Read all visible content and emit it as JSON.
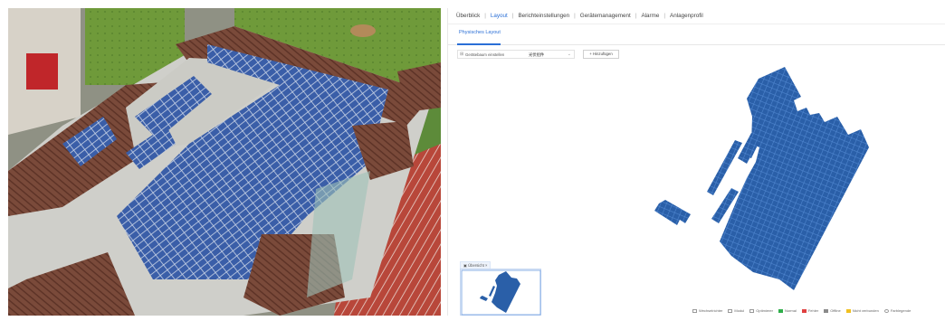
{
  "nav": {
    "items": [
      {
        "label": "Überblick",
        "active": false
      },
      {
        "label": "Layout",
        "active": true
      },
      {
        "label": "Berichteinstellungen",
        "active": false
      },
      {
        "label": "Gerätemanagement",
        "active": false
      },
      {
        "label": "Alarme",
        "active": false
      },
      {
        "label": "Anlagenprofil",
        "active": false
      }
    ]
  },
  "subtab": {
    "label": "Physisches Layout"
  },
  "toolbar": {
    "select_label": "Gerätebaum einstellen",
    "select_value": "光伏组件",
    "add_button": "+ Hinzufügen",
    "search_icon": "tree-icon",
    "chevron_icon": "chevron-down-icon"
  },
  "overview": {
    "label": "Übersicht",
    "icon": "map-icon"
  },
  "legend": [
    {
      "label": "Wechselrichter",
      "color": "#ffffff"
    },
    {
      "label": "Modul",
      "color": "#ffffff"
    },
    {
      "label": "Optimierer",
      "color": "#ffffff"
    },
    {
      "label": "Normal",
      "color": "#2fae4a"
    },
    {
      "label": "Fehler",
      "color": "#e04040"
    },
    {
      "label": "Offline",
      "color": "#8a8a8a"
    },
    {
      "label": "Nicht verbunden",
      "color": "#f0c020"
    },
    {
      "label": "Farblegende",
      "color": "#ffffff"
    }
  ],
  "colors": {
    "accent": "#2a6fd6",
    "module_fill": "#2a5fa8",
    "module_grid": "#4f86cf"
  }
}
